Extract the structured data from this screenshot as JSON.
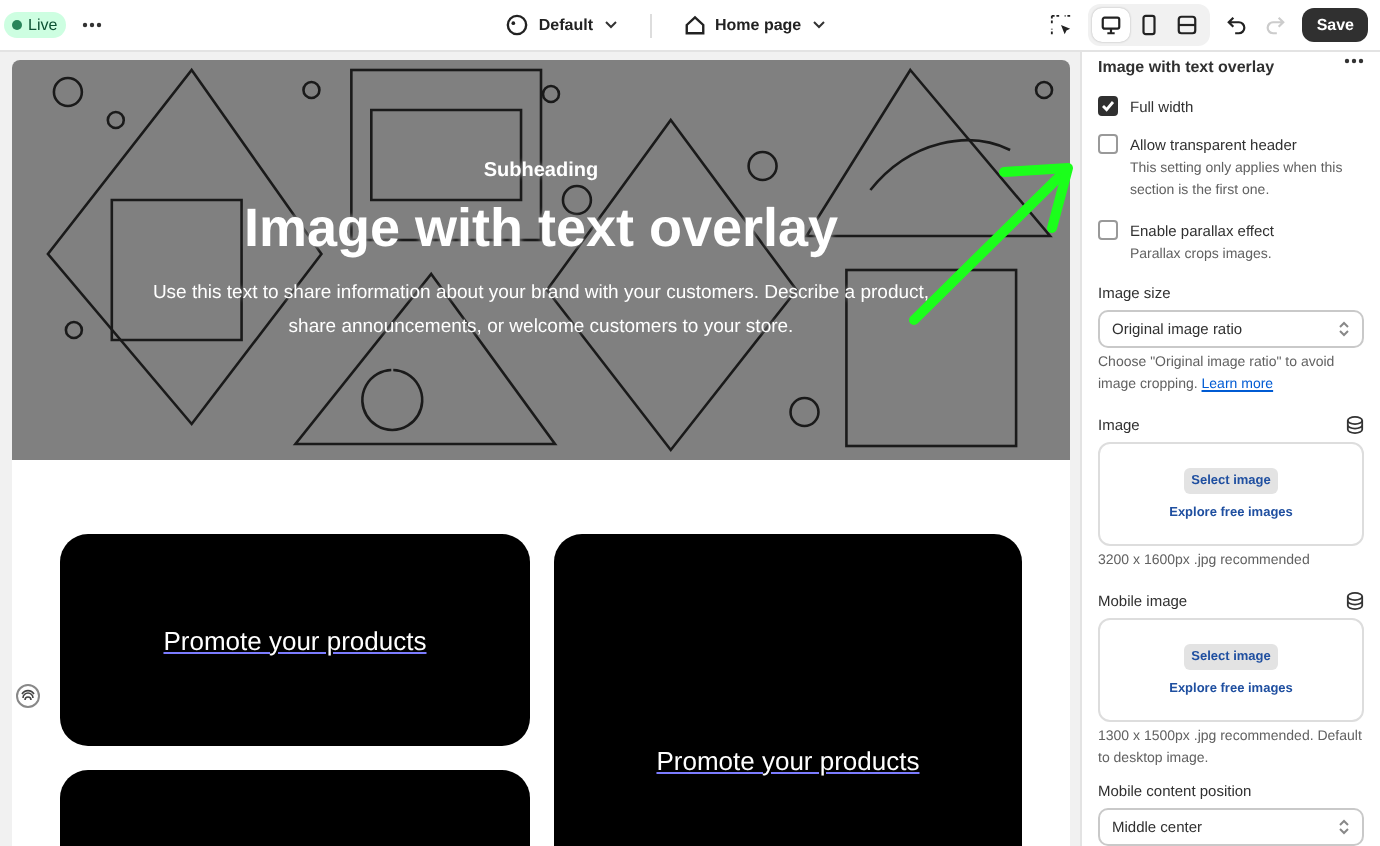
{
  "topbar": {
    "status": "Live",
    "theme": "Default",
    "page": "Home page",
    "views": [
      {
        "kind": "desktop",
        "selected": true
      },
      {
        "kind": "mobile",
        "selected": false
      },
      {
        "kind": "fullscreen",
        "selected": false
      }
    ],
    "save": "Save"
  },
  "hero": {
    "subheading": "Subheading",
    "heading": "Image with text overlay",
    "text": "Use this text to share information about your brand with your customers. Describe a product, share announcements, or welcome customers to your store."
  },
  "cards": [
    {
      "kind": "titled",
      "title": "Promote your products"
    },
    {
      "kind": "titled",
      "title": "Promote your products"
    },
    {
      "kind": "blank"
    }
  ],
  "panel": {
    "title": "Image with text overlay",
    "checkboxes": [
      {
        "label": "Full width",
        "checked": true
      },
      {
        "label": "Allow transparent header",
        "checked": false,
        "help": "This setting only applies when this section is the first one."
      },
      {
        "label": "Enable parallax effect",
        "checked": false,
        "help": "Parallax crops images."
      }
    ],
    "image_size": {
      "label": "Image size",
      "value": "Original image ratio",
      "help": "Choose \"Original image ratio\" to avoid image cropping.",
      "link": "Learn more"
    },
    "pickers": [
      {
        "label": "Image",
        "button": "Select image",
        "link": "Explore free images",
        "note": "3200 x 1600px .jpg recommended"
      },
      {
        "label": "Mobile image",
        "button": "Select image",
        "link": "Explore free images",
        "note": "1300 x 1500px .jpg recommended. Default to desktop image."
      }
    ],
    "position": {
      "label": "Mobile content position",
      "value": "Middle center"
    }
  }
}
